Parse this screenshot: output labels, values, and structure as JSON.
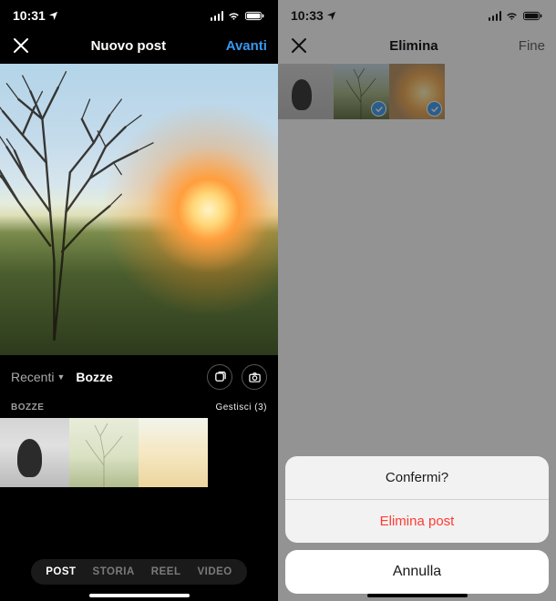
{
  "left": {
    "status": {
      "time": "10:31",
      "has_location": true
    },
    "nav": {
      "title": "Nuovo post",
      "next": "Avanti"
    },
    "albums": {
      "recent": "Recenti",
      "drafts": "Bozze"
    },
    "drafts_section": {
      "heading": "BOZZE",
      "manage": "Gestisci (3)"
    },
    "tabs": {
      "post": "POST",
      "story": "STORIA",
      "reel": "REEL",
      "video": "VIDEO"
    }
  },
  "right": {
    "status": {
      "time": "10:33",
      "has_location": true
    },
    "nav": {
      "title": "Elimina",
      "done": "Fine"
    },
    "action_sheet": {
      "confirm": "Confermi?",
      "delete": "Elimina post",
      "cancel": "Annulla"
    }
  },
  "colors": {
    "accent": "#3897f0",
    "destructive": "#ff3b30"
  }
}
